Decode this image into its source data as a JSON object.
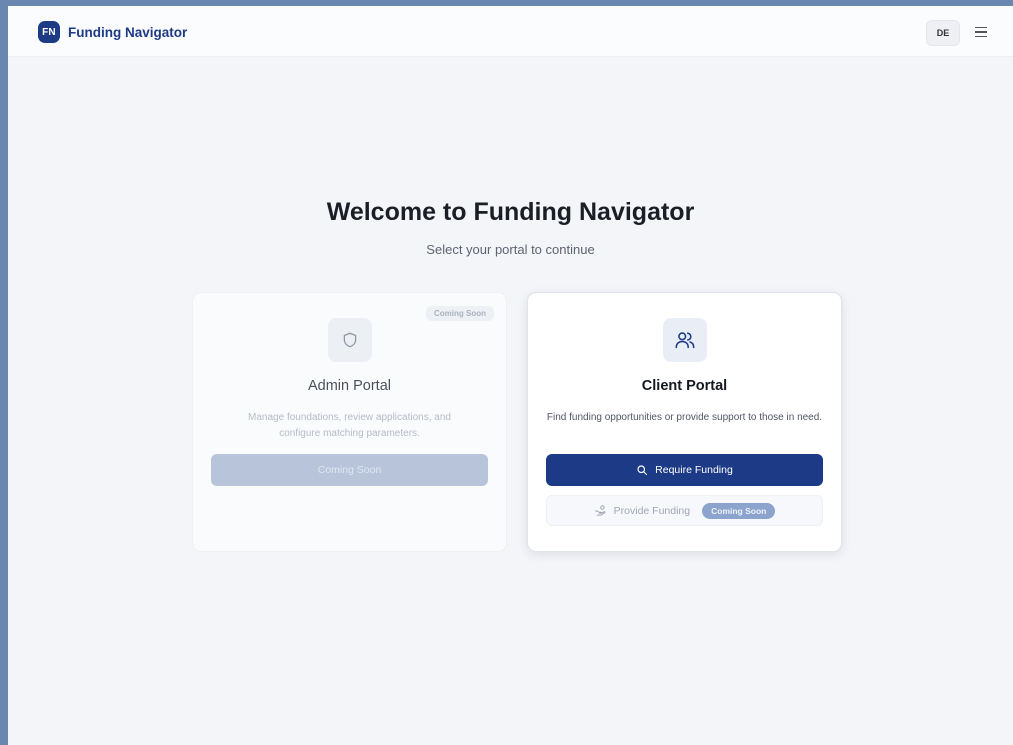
{
  "header": {
    "logo_text": "FN",
    "app_name": "Funding Navigator",
    "language_button": "DE"
  },
  "main": {
    "title": "Welcome to Funding Navigator",
    "subtitle": "Select your portal to continue"
  },
  "admin_portal": {
    "badge": "Coming Soon",
    "title": "Admin Portal",
    "description": "Manage foundations, review applications, and configure matching parameters.",
    "button_label": "Coming Soon",
    "icon": "shield-icon"
  },
  "client_portal": {
    "title": "Client Portal",
    "description": "Find funding opportunities or provide support to those in need.",
    "primary_button_label": "Require Funding",
    "secondary_button_label": "Provide Funding",
    "secondary_badge": "Coming Soon",
    "icon": "users-icon",
    "primary_icon": "search-icon",
    "secondary_icon": "hand-coins-icon"
  },
  "colors": {
    "brand": "#1c3a86",
    "background": "#f3f5f9",
    "disabled_button": "#b8c4d9"
  }
}
